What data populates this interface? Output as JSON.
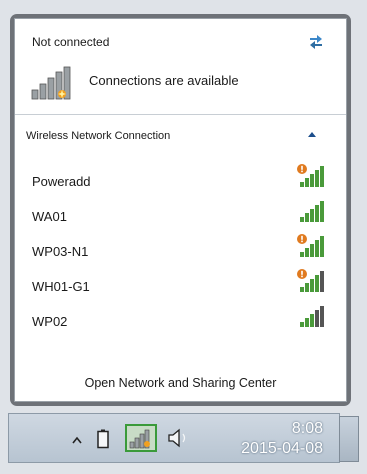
{
  "popup": {
    "status_title": "Not connected",
    "connections_text": "Connections are available",
    "section_title": "Wireless Network Connection",
    "footer_link": "Open Network and Sharing Center",
    "networks": [
      {
        "name": "Poweradd",
        "security_warning": true,
        "signal_bars": 4
      },
      {
        "name": "WA01",
        "security_warning": false,
        "signal_bars": 4
      },
      {
        "name": "WP03-N1",
        "security_warning": true,
        "signal_bars": 4
      },
      {
        "name": "WH01-G1",
        "security_warning": true,
        "signal_bars": 3
      },
      {
        "name": "WP02",
        "security_warning": false,
        "signal_bars": 3
      }
    ]
  },
  "taskbar": {
    "time": "8:08",
    "date": "2015-04-08",
    "icons": [
      "show-hidden-icons-arrow",
      "battery-icon",
      "network-icon",
      "volume-icon"
    ]
  },
  "colors": {
    "signal_green": "#4a9a3a",
    "signal_dark": "#444444",
    "warning_orange": "#e07a1f",
    "taskbar_highlight": "#3a9a3a"
  }
}
